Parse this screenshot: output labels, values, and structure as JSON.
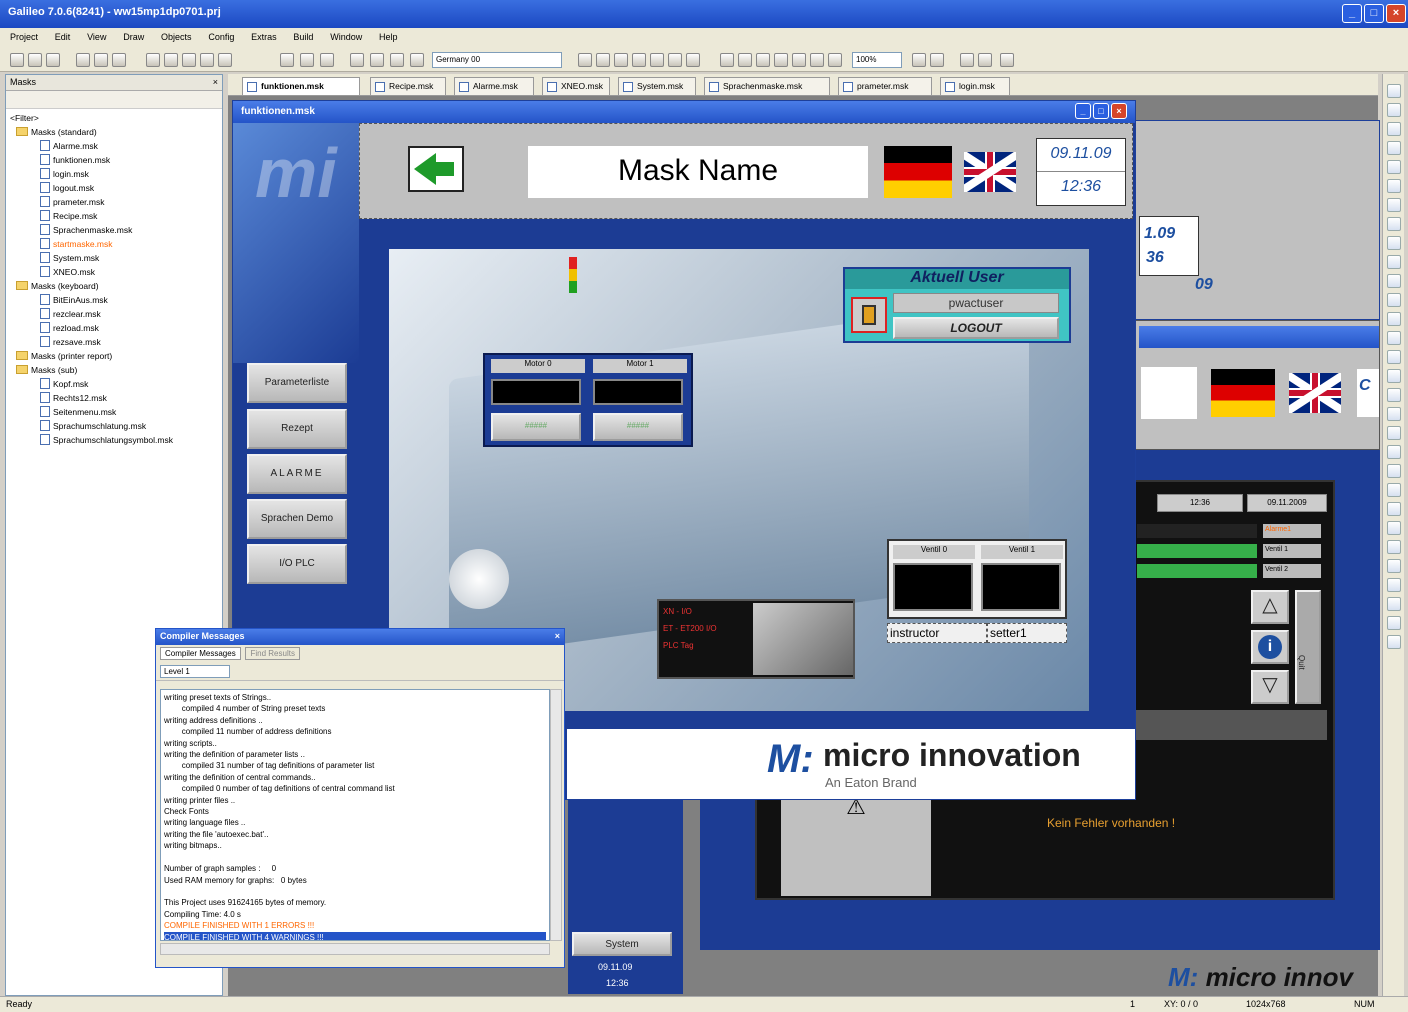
{
  "window": {
    "title": "Galileo 7.0.6(8241) - ww15mp1dp0701.prj"
  },
  "menu": [
    "Project",
    "Edit",
    "View",
    "Draw",
    "Objects",
    "Config",
    "Extras",
    "Build",
    "Window",
    "Help"
  ],
  "toolbar": {
    "language_select": "Germany 00",
    "zoom_select": "100%"
  },
  "masks_panel": {
    "title": "Masks",
    "filter": "<Filter>",
    "tree": [
      {
        "label": "Masks (standard)",
        "level": 0,
        "type": "folder"
      },
      {
        "label": "Alarme.msk",
        "level": 1,
        "type": "file"
      },
      {
        "label": "funktionen.msk",
        "level": 1,
        "type": "file"
      },
      {
        "label": "login.msk",
        "level": 1,
        "type": "file"
      },
      {
        "label": "logout.msk",
        "level": 1,
        "type": "file"
      },
      {
        "label": "prameter.msk",
        "level": 1,
        "type": "file"
      },
      {
        "label": "Recipe.msk",
        "level": 1,
        "type": "file"
      },
      {
        "label": "Sprachenmaske.msk",
        "level": 1,
        "type": "file"
      },
      {
        "label": "startmaske.msk",
        "level": 1,
        "type": "file",
        "highlight": true
      },
      {
        "label": "System.msk",
        "level": 1,
        "type": "file"
      },
      {
        "label": "XNEO.msk",
        "level": 1,
        "type": "file"
      },
      {
        "label": "Masks (keyboard)",
        "level": 0,
        "type": "folder"
      },
      {
        "label": "BitEinAus.msk",
        "level": 1,
        "type": "file"
      },
      {
        "label": "rezclear.msk",
        "level": 1,
        "type": "file"
      },
      {
        "label": "rezload.msk",
        "level": 1,
        "type": "file"
      },
      {
        "label": "rezsave.msk",
        "level": 1,
        "type": "file"
      },
      {
        "label": "Masks (printer report)",
        "level": 0,
        "type": "folder"
      },
      {
        "label": "Masks (sub)",
        "level": 0,
        "type": "folder"
      },
      {
        "label": "Kopf.msk",
        "level": 1,
        "type": "file"
      },
      {
        "label": "Rechts12.msk",
        "level": 1,
        "type": "file"
      },
      {
        "label": "Seitenmenu.msk",
        "level": 1,
        "type": "file"
      },
      {
        "label": "Sprachumschlatung.msk",
        "level": 1,
        "type": "file"
      },
      {
        "label": "Sprachumschlatungsymbol.msk",
        "level": 1,
        "type": "file"
      }
    ]
  },
  "tabs": [
    {
      "label": "funktionen.msk",
      "active": true
    },
    {
      "label": "Recipe.msk"
    },
    {
      "label": "Alarme.msk"
    },
    {
      "label": "XNEO.msk"
    },
    {
      "label": "System.msk"
    },
    {
      "label": "Sprachenmaske.msk"
    },
    {
      "label": "prameter.msk"
    },
    {
      "label": "login.msk"
    }
  ],
  "main_mask": {
    "title": "funktionen.msk",
    "mask_name": "Mask Name",
    "date": "09.11.09",
    "time": "12:36",
    "side_buttons": [
      "Parameterliste",
      "Rezept",
      "ALARME",
      "Sprachen Demo",
      "I/O PLC"
    ],
    "user_panel": {
      "title": "Aktuell User",
      "user": "pwactuser",
      "logout": "LOGOUT"
    },
    "motors": [
      {
        "label": "Motor 0",
        "value": "#####"
      },
      {
        "label": "Motor 1",
        "value": "#####"
      }
    ],
    "valves": [
      {
        "label": "Ventil 0"
      },
      {
        "label": "Ventil 1"
      }
    ],
    "roles": [
      "instructor",
      "setter1"
    ],
    "plc_info": [
      "XN - I/O",
      "ET - ET200 I/O",
      "PLC Tag"
    ],
    "logo": {
      "brand": "micro innovation",
      "sub": "An Eaton Brand"
    }
  },
  "background_masks": {
    "date_partial": "1.09",
    "time_partial": "36",
    "date_partial2": "09",
    "alarm_time": "12:36",
    "alarm_date": "09.11.2009",
    "alarm_rows": [
      "Alarme1",
      "Ventil 1",
      "Ventil 2"
    ],
    "no_error": "Kein Fehler vorhanden !",
    "quit": "Quit",
    "system_btn": "System",
    "system_date": "09.11.09",
    "system_time": "12:36",
    "logo_partial": "micro innov",
    "c_partial": "C"
  },
  "compiler": {
    "title": "Compiler Messages",
    "tab_active": "Compiler Messages",
    "tab_inactive": "Find Results",
    "level": "Level 1",
    "log": [
      "writing preset texts of Strings..",
      "        compiled 4 number of String preset texts",
      "writing address definitions ..",
      "        compiled 11 number of address definitions",
      "writing scripts..",
      "writing the definition of parameter lists ..",
      "        compiled 31 number of tag definitions of parameter list",
      "writing the definition of central commands..",
      "        compiled 0 number of tag definitions of central command list",
      "writing printer files ..",
      "Check Fonts",
      "writing language files ..",
      "writing the file 'autoexec.bat'..",
      "writing bitmaps..",
      "",
      "Number of graph samples :     0",
      "Used RAM memory for graphs:   0 bytes",
      "",
      "This Project uses 91624165 bytes of memory.",
      "Compiling Time: 4.0 s"
    ],
    "error_line": "COMPILE FINISHED WITH 1 ERRORS !!!",
    "warn_line": "COMPILE FINISHED WITH 4 WARNINGS !!!"
  },
  "status": {
    "left": "Ready",
    "page": "1",
    "xy": "XY: 0 / 0",
    "size": "1024x768",
    "num": "NUM"
  },
  "colors": {
    "title_blue": "#2454c8",
    "mask_blue": "#1c3c94",
    "accent_orange": "#ff6600",
    "logo_blue": "#1d4fa0"
  }
}
